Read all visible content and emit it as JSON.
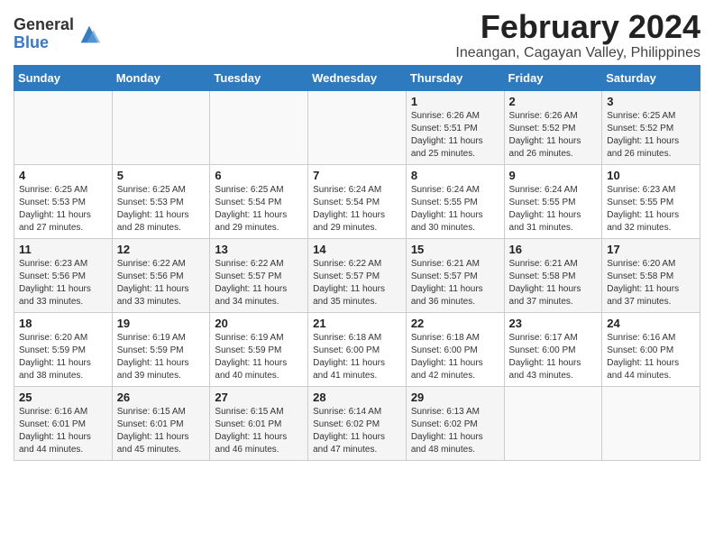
{
  "logo": {
    "general": "General",
    "blue": "Blue"
  },
  "title": "February 2024",
  "subtitle": "Ineangan, Cagayan Valley, Philippines",
  "days_of_week": [
    "Sunday",
    "Monday",
    "Tuesday",
    "Wednesday",
    "Thursday",
    "Friday",
    "Saturday"
  ],
  "weeks": [
    [
      {
        "day": "",
        "info": ""
      },
      {
        "day": "",
        "info": ""
      },
      {
        "day": "",
        "info": ""
      },
      {
        "day": "",
        "info": ""
      },
      {
        "day": "1",
        "info": "Sunrise: 6:26 AM\nSunset: 5:51 PM\nDaylight: 11 hours and 25 minutes."
      },
      {
        "day": "2",
        "info": "Sunrise: 6:26 AM\nSunset: 5:52 PM\nDaylight: 11 hours and 26 minutes."
      },
      {
        "day": "3",
        "info": "Sunrise: 6:25 AM\nSunset: 5:52 PM\nDaylight: 11 hours and 26 minutes."
      }
    ],
    [
      {
        "day": "4",
        "info": "Sunrise: 6:25 AM\nSunset: 5:53 PM\nDaylight: 11 hours and 27 minutes."
      },
      {
        "day": "5",
        "info": "Sunrise: 6:25 AM\nSunset: 5:53 PM\nDaylight: 11 hours and 28 minutes."
      },
      {
        "day": "6",
        "info": "Sunrise: 6:25 AM\nSunset: 5:54 PM\nDaylight: 11 hours and 29 minutes."
      },
      {
        "day": "7",
        "info": "Sunrise: 6:24 AM\nSunset: 5:54 PM\nDaylight: 11 hours and 29 minutes."
      },
      {
        "day": "8",
        "info": "Sunrise: 6:24 AM\nSunset: 5:55 PM\nDaylight: 11 hours and 30 minutes."
      },
      {
        "day": "9",
        "info": "Sunrise: 6:24 AM\nSunset: 5:55 PM\nDaylight: 11 hours and 31 minutes."
      },
      {
        "day": "10",
        "info": "Sunrise: 6:23 AM\nSunset: 5:55 PM\nDaylight: 11 hours and 32 minutes."
      }
    ],
    [
      {
        "day": "11",
        "info": "Sunrise: 6:23 AM\nSunset: 5:56 PM\nDaylight: 11 hours and 33 minutes."
      },
      {
        "day": "12",
        "info": "Sunrise: 6:22 AM\nSunset: 5:56 PM\nDaylight: 11 hours and 33 minutes."
      },
      {
        "day": "13",
        "info": "Sunrise: 6:22 AM\nSunset: 5:57 PM\nDaylight: 11 hours and 34 minutes."
      },
      {
        "day": "14",
        "info": "Sunrise: 6:22 AM\nSunset: 5:57 PM\nDaylight: 11 hours and 35 minutes."
      },
      {
        "day": "15",
        "info": "Sunrise: 6:21 AM\nSunset: 5:57 PM\nDaylight: 11 hours and 36 minutes."
      },
      {
        "day": "16",
        "info": "Sunrise: 6:21 AM\nSunset: 5:58 PM\nDaylight: 11 hours and 37 minutes."
      },
      {
        "day": "17",
        "info": "Sunrise: 6:20 AM\nSunset: 5:58 PM\nDaylight: 11 hours and 37 minutes."
      }
    ],
    [
      {
        "day": "18",
        "info": "Sunrise: 6:20 AM\nSunset: 5:59 PM\nDaylight: 11 hours and 38 minutes."
      },
      {
        "day": "19",
        "info": "Sunrise: 6:19 AM\nSunset: 5:59 PM\nDaylight: 11 hours and 39 minutes."
      },
      {
        "day": "20",
        "info": "Sunrise: 6:19 AM\nSunset: 5:59 PM\nDaylight: 11 hours and 40 minutes."
      },
      {
        "day": "21",
        "info": "Sunrise: 6:18 AM\nSunset: 6:00 PM\nDaylight: 11 hours and 41 minutes."
      },
      {
        "day": "22",
        "info": "Sunrise: 6:18 AM\nSunset: 6:00 PM\nDaylight: 11 hours and 42 minutes."
      },
      {
        "day": "23",
        "info": "Sunrise: 6:17 AM\nSunset: 6:00 PM\nDaylight: 11 hours and 43 minutes."
      },
      {
        "day": "24",
        "info": "Sunrise: 6:16 AM\nSunset: 6:00 PM\nDaylight: 11 hours and 44 minutes."
      }
    ],
    [
      {
        "day": "25",
        "info": "Sunrise: 6:16 AM\nSunset: 6:01 PM\nDaylight: 11 hours and 44 minutes."
      },
      {
        "day": "26",
        "info": "Sunrise: 6:15 AM\nSunset: 6:01 PM\nDaylight: 11 hours and 45 minutes."
      },
      {
        "day": "27",
        "info": "Sunrise: 6:15 AM\nSunset: 6:01 PM\nDaylight: 11 hours and 46 minutes."
      },
      {
        "day": "28",
        "info": "Sunrise: 6:14 AM\nSunset: 6:02 PM\nDaylight: 11 hours and 47 minutes."
      },
      {
        "day": "29",
        "info": "Sunrise: 6:13 AM\nSunset: 6:02 PM\nDaylight: 11 hours and 48 minutes."
      },
      {
        "day": "",
        "info": ""
      },
      {
        "day": "",
        "info": ""
      }
    ]
  ]
}
